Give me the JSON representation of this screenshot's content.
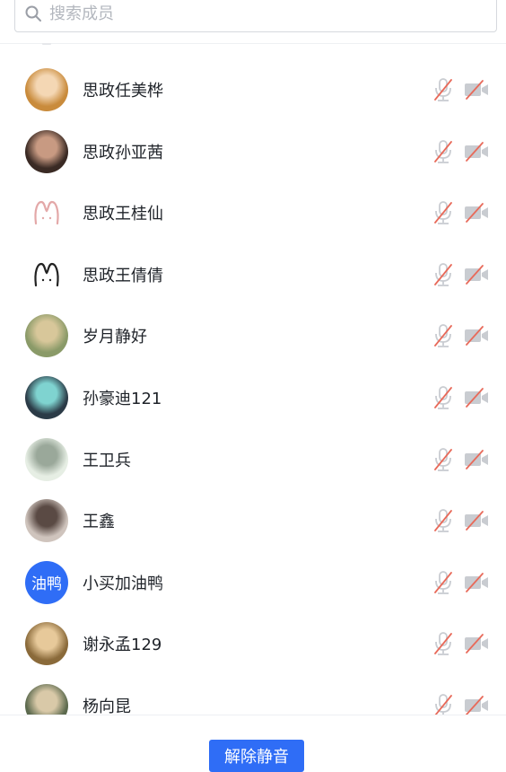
{
  "search": {
    "placeholder": "搜索成员"
  },
  "members": [
    {
      "name": "思政任美桦",
      "avatar": {
        "type": "image",
        "bg": "#c98b3c",
        "fg": "#f4d7b4"
      }
    },
    {
      "name": "思政孙亚茜",
      "avatar": {
        "type": "image",
        "bg": "#3a2a24",
        "fg": "#c89a82"
      }
    },
    {
      "name": "思政王桂仙",
      "avatar": {
        "type": "icon",
        "bg": "#ffffff",
        "fg": "#e3a8a8"
      }
    },
    {
      "name": "思政王倩倩",
      "avatar": {
        "type": "icon",
        "bg": "#ffffff",
        "fg": "#222222"
      }
    },
    {
      "name": "岁月静好",
      "avatar": {
        "type": "image",
        "bg": "#8a9a68",
        "fg": "#d8c79a"
      }
    },
    {
      "name": "孙豪迪121",
      "avatar": {
        "type": "image",
        "bg": "#2b3b47",
        "fg": "#7fd3d0"
      }
    },
    {
      "name": "王卫兵",
      "avatar": {
        "type": "image",
        "bg": "#e6eee4",
        "fg": "#9aa89a"
      }
    },
    {
      "name": "王鑫",
      "avatar": {
        "type": "image",
        "bg": "#cfc4bd",
        "fg": "#5a4a44"
      }
    },
    {
      "name": "小买加油鸭",
      "avatar": {
        "type": "text",
        "text": "油鸭",
        "bg": "#2f6df6",
        "fg": "#ffffff"
      }
    },
    {
      "name": "谢永孟129",
      "avatar": {
        "type": "image",
        "bg": "#8a6a3a",
        "fg": "#e7c99a"
      }
    },
    {
      "name": "杨向昆",
      "avatar": {
        "type": "image",
        "bg": "#5c6a4e",
        "fg": "#d9c9a8"
      }
    }
  ],
  "icons": {
    "mic": "mic-muted-icon",
    "camera": "camera-off-icon",
    "search": "search-icon"
  },
  "colors": {
    "primary": "#2f6df6",
    "muted_icon": "#c9ccd1",
    "muted_slash": "#e86a5a"
  },
  "footer": {
    "unmute_all": "解除静音"
  }
}
